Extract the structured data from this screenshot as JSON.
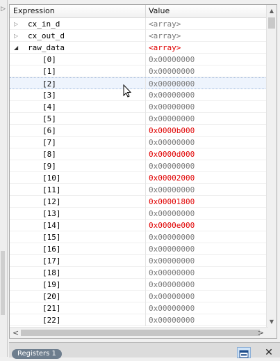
{
  "watch": {
    "columns": {
      "expression": "Expression",
      "value": "Value"
    },
    "rows": [
      {
        "name": "cx_in_d",
        "value": "<array>",
        "expand": "▷",
        "level": "top",
        "changed": false
      },
      {
        "name": "cx_out_d",
        "value": "<array>",
        "expand": "▷",
        "level": "top",
        "changed": false
      },
      {
        "name": "raw_data",
        "value": "<array>",
        "expand": "◢",
        "level": "top",
        "changed": true
      },
      {
        "name": "[0]",
        "value": "0x00000000",
        "level": "child",
        "changed": false
      },
      {
        "name": "[1]",
        "value": "0x00000000",
        "level": "child",
        "changed": false
      },
      {
        "name": "[2]",
        "value": "0x00000000",
        "level": "child",
        "changed": false,
        "selected": true
      },
      {
        "name": "[3]",
        "value": "0x00000000",
        "level": "child",
        "changed": false
      },
      {
        "name": "[4]",
        "value": "0x00000000",
        "level": "child",
        "changed": false
      },
      {
        "name": "[5]",
        "value": "0x00000000",
        "level": "child",
        "changed": false
      },
      {
        "name": "[6]",
        "value": "0x0000b000",
        "level": "child",
        "changed": true
      },
      {
        "name": "[7]",
        "value": "0x00000000",
        "level": "child",
        "changed": false
      },
      {
        "name": "[8]",
        "value": "0x0000d000",
        "level": "child",
        "changed": true
      },
      {
        "name": "[9]",
        "value": "0x00000000",
        "level": "child",
        "changed": false
      },
      {
        "name": "[10]",
        "value": "0x00002000",
        "level": "child",
        "changed": true
      },
      {
        "name": "[11]",
        "value": "0x00000000",
        "level": "child",
        "changed": false
      },
      {
        "name": "[12]",
        "value": "0x00001800",
        "level": "child",
        "changed": true
      },
      {
        "name": "[13]",
        "value": "0x00000000",
        "level": "child",
        "changed": false
      },
      {
        "name": "[14]",
        "value": "0x0000e000",
        "level": "child",
        "changed": true
      },
      {
        "name": "[15]",
        "value": "0x00000000",
        "level": "child",
        "changed": false
      },
      {
        "name": "[16]",
        "value": "0x00000000",
        "level": "child",
        "changed": false
      },
      {
        "name": "[17]",
        "value": "0x00000000",
        "level": "child",
        "changed": false
      },
      {
        "name": "[18]",
        "value": "0x00000000",
        "level": "child",
        "changed": false
      },
      {
        "name": "[19]",
        "value": "0x00000000",
        "level": "child",
        "changed": false
      },
      {
        "name": "[20]",
        "value": "0x00000000",
        "level": "child",
        "changed": false
      },
      {
        "name": "[21]",
        "value": "0x00000000",
        "level": "child",
        "changed": false
      },
      {
        "name": "[22]",
        "value": "0x00000000",
        "level": "child",
        "changed": false
      }
    ],
    "colors": {
      "changed": "#e00000",
      "unchanged": "#7a7a7a"
    }
  },
  "bottom_bar": {
    "tab_label": "Registers 1",
    "window_icon": "window-icon",
    "close_icon": "close-icon",
    "close_glyph": "✕"
  },
  "scroll": {
    "up_glyph": "▲",
    "down_glyph": "▼",
    "left_glyph": "<",
    "right_glyph": ">"
  },
  "left_strip": {
    "arrow_glyph": "▷"
  }
}
